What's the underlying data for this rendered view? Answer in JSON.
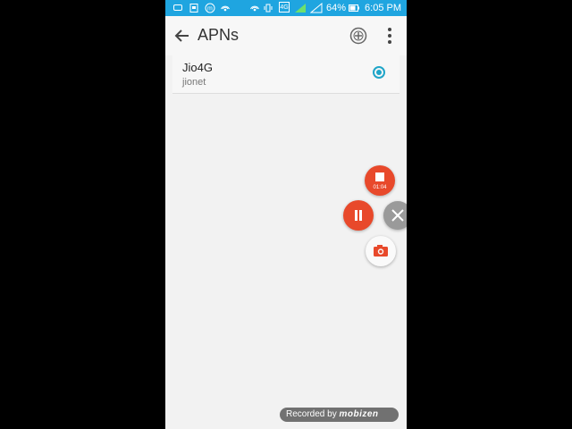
{
  "status_bar": {
    "network": "4G",
    "battery_percent": "64%",
    "time": "6:05 PM",
    "bg_color": "#1fa5e0"
  },
  "app_bar": {
    "title": "APNs",
    "icons": [
      "back-arrow-icon",
      "add-apn-icon",
      "more-vert-icon"
    ]
  },
  "apn_list": [
    {
      "name": "Jio4G",
      "apn": "jionet",
      "selected": true
    }
  ],
  "recorder": {
    "elapsed": "01:04",
    "accent_color": "#e8492b"
  },
  "watermark": {
    "prefix": "Recorded by",
    "brand": "mobizen"
  }
}
